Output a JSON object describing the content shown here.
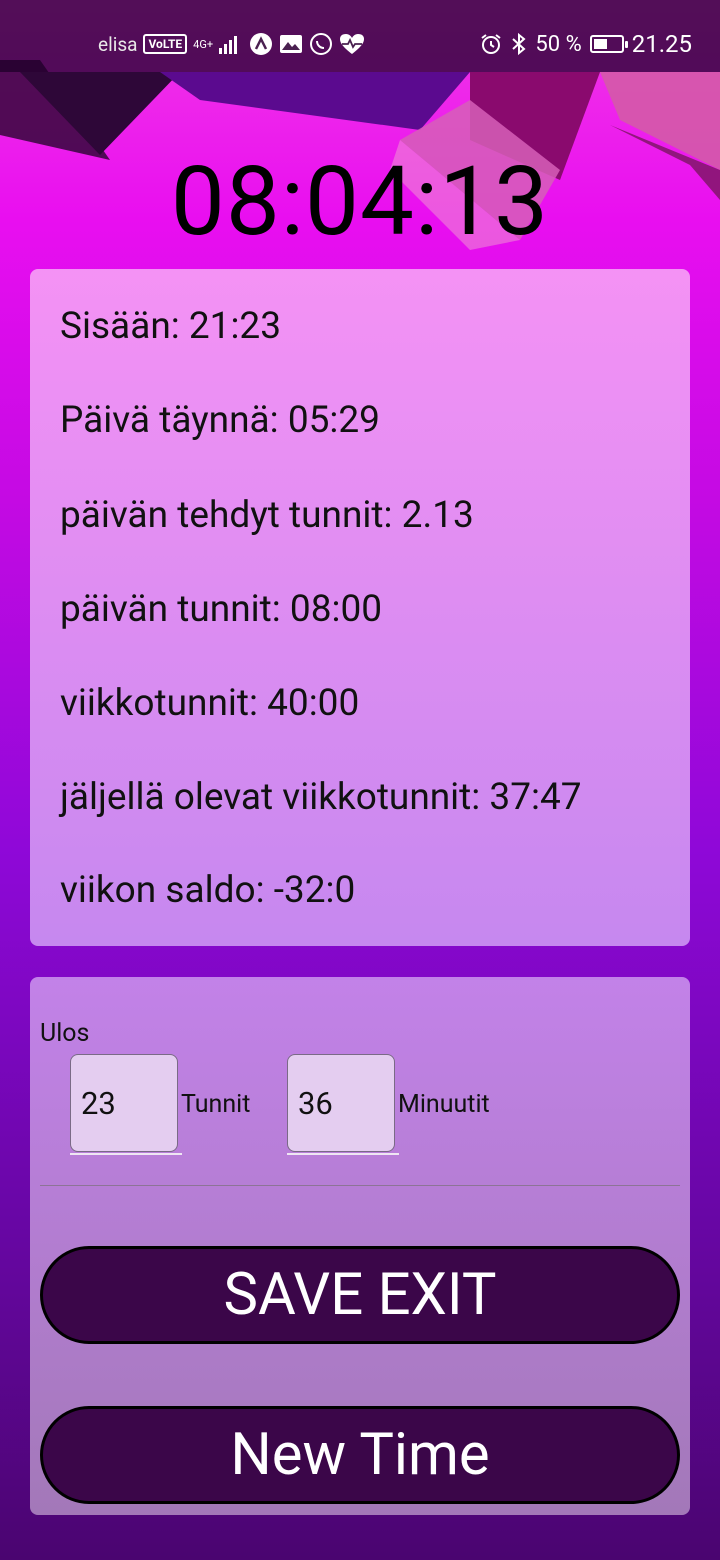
{
  "status_bar": {
    "carrier": "elisa",
    "volte": "VoLTE",
    "network": "4G+",
    "battery_percent": "50 %",
    "time": "21.25",
    "battery_level": 0.5
  },
  "clock": {
    "value": "08:04:13"
  },
  "info": {
    "lines": [
      "Sisään: 21:23",
      "Päivä täynnä: 05:29",
      "päivän tehdyt tunnit: 2.13",
      "päivän tunnit: 08:00",
      "viikkotunnit: 40:00",
      "jäljellä olevat viikkotunnit: 37:47",
      "viikon saldo: -32:0"
    ]
  },
  "exit_form": {
    "label": "Ulos",
    "hours_value": "23",
    "hours_unit": "Tunnit",
    "minutes_value": "36",
    "minutes_unit": "Minuutit"
  },
  "buttons": {
    "save_exit": "SAVE EXIT",
    "new_time": "New Time"
  },
  "colors": {
    "background_top": "#f23ae6",
    "background_bottom": "#4a0570",
    "button_fill": "#3b0649"
  }
}
